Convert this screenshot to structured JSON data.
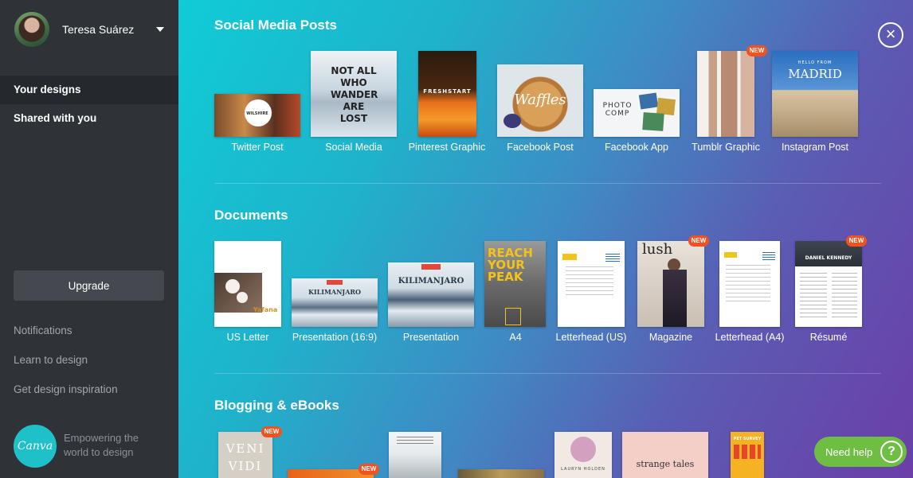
{
  "user": {
    "name": "Teresa Suárez"
  },
  "nav": {
    "your_designs": "Your designs",
    "shared": "Shared with you",
    "upgrade": "Upgrade",
    "notifications": "Notifications",
    "learn": "Learn to design",
    "inspiration": "Get design inspiration"
  },
  "brand": {
    "logo": "Canva",
    "tagline": "Empowering the world to design"
  },
  "close_icon": "×",
  "new_badge": "NEW",
  "sections": {
    "social": {
      "title": "Social Media Posts",
      "items": [
        {
          "label": "Twitter Post",
          "thumb_text": "WILSHIRE"
        },
        {
          "label": "Social Media",
          "thumb_text": "NOT ALL WHO WANDER ARE LOST"
        },
        {
          "label": "Pinterest Graphic",
          "thumb_text": "FRESHSTART"
        },
        {
          "label": "Facebook Post",
          "thumb_text": "Waffles"
        },
        {
          "label": "Facebook App",
          "thumb_text": "PHOTO COMP"
        },
        {
          "label": "Tumblr Graphic",
          "thumb_text": ""
        },
        {
          "label": "Instagram Post",
          "thumb_text": "MADRID",
          "thumb_sub": "HELLO FROM"
        }
      ]
    },
    "documents": {
      "title": "Documents",
      "items": [
        {
          "label": "US Letter",
          "thumb_text": "Yafana"
        },
        {
          "label": "Presentation (16:9)",
          "thumb_text": "KILIMANJARO"
        },
        {
          "label": "Presentation",
          "thumb_text": "KILIMANJARO"
        },
        {
          "label": "A4",
          "thumb_text": "REACH YOUR PEAK"
        },
        {
          "label": "Letterhead (US)",
          "thumb_text": ""
        },
        {
          "label": "Magazine",
          "thumb_text": "lush"
        },
        {
          "label": "Letterhead (A4)",
          "thumb_text": ""
        },
        {
          "label": "Résumé",
          "thumb_text": "DANIEL KENNEDY"
        }
      ]
    },
    "blogging": {
      "title": "Blogging & eBooks",
      "items": [
        {
          "thumb_text": "VENI VIDI"
        },
        {
          "thumb_text": ""
        },
        {
          "thumb_text": ""
        },
        {
          "thumb_text": ""
        },
        {
          "thumb_text": "LAURYN HOLDEN"
        },
        {
          "thumb_text": "strange tales"
        },
        {
          "thumb_text": "PET SURVEY"
        }
      ]
    }
  },
  "help": {
    "label": "Need help",
    "icon": "?"
  },
  "colors": {
    "accent": "#00c4cc",
    "new_badge": "#f4511e",
    "help": "#6fbe44",
    "sidebar": "#2f3338"
  }
}
